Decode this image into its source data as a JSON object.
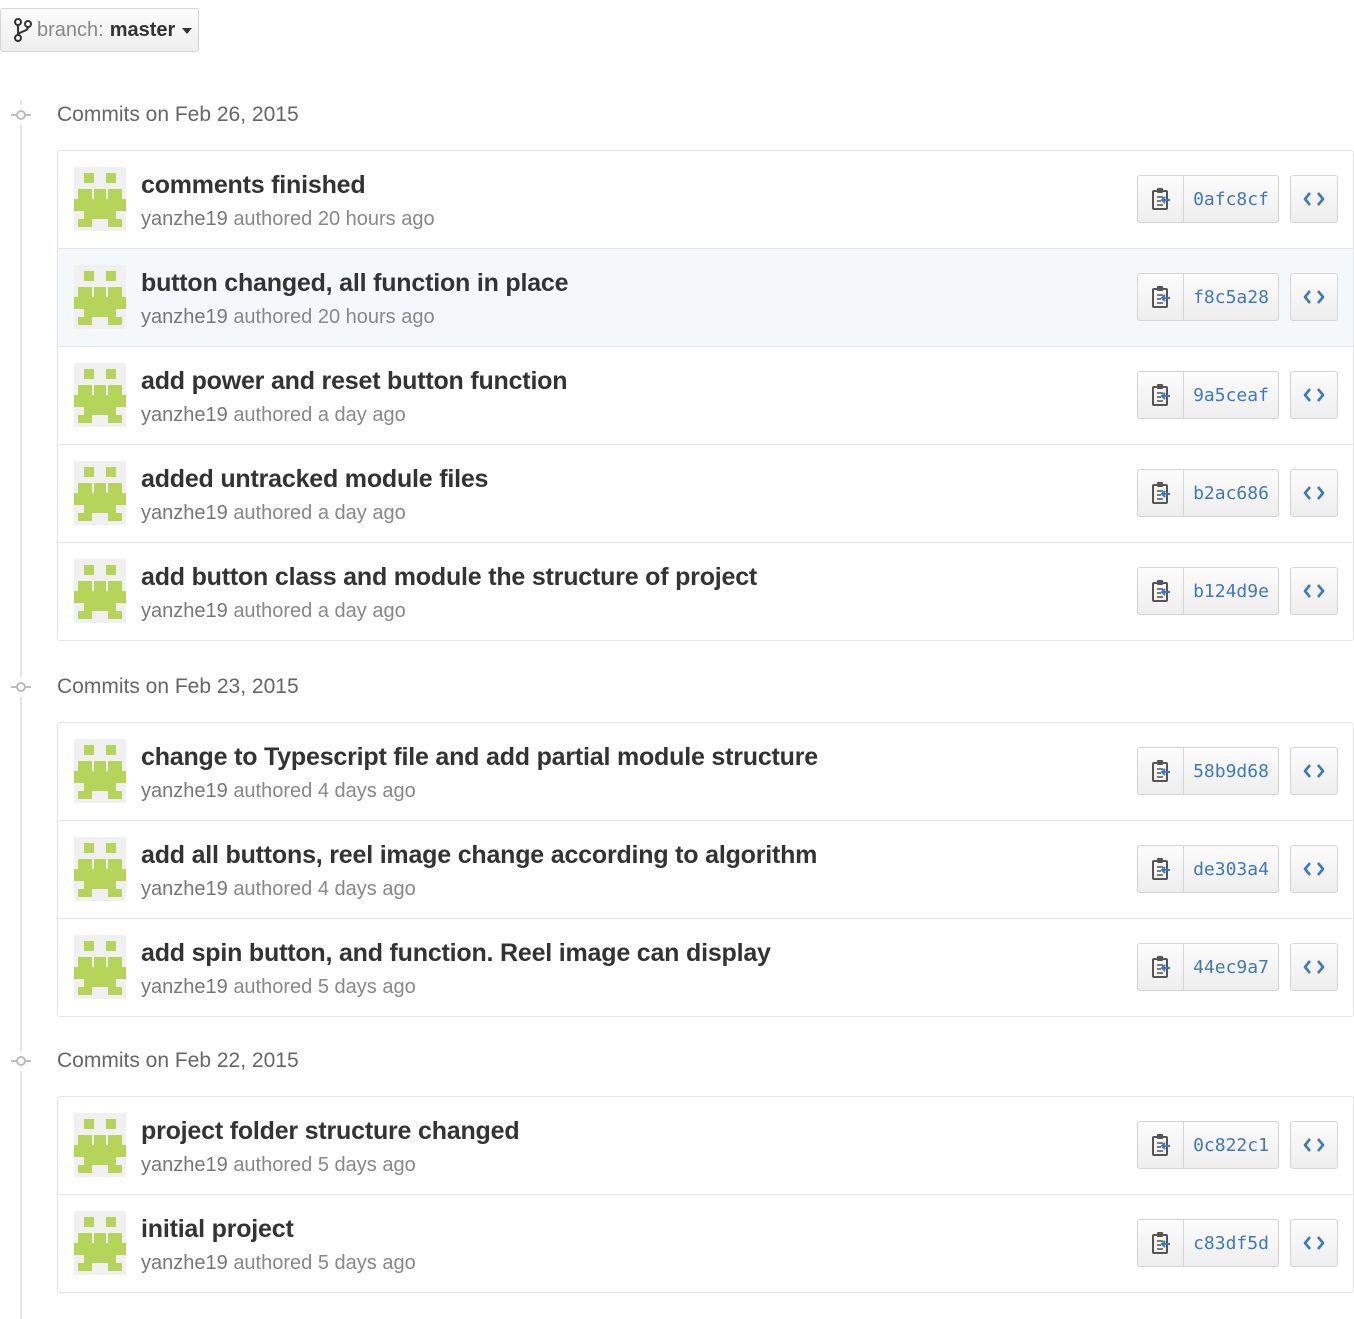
{
  "branch": {
    "prefix": "branch:",
    "name": "master"
  },
  "groups": [
    {
      "title": "Commits on Feb 26, 2015",
      "commits": [
        {
          "message": "comments finished",
          "author": "yanzhe19",
          "verb": "authored",
          "time": "20 hours ago",
          "sha": "0afc8cf"
        },
        {
          "message": "button changed, all function in place",
          "author": "yanzhe19",
          "verb": "authored",
          "time": "20 hours ago",
          "sha": "f8c5a28"
        },
        {
          "message": "add power and reset button function",
          "author": "yanzhe19",
          "verb": "authored",
          "time": "a day ago",
          "sha": "9a5ceaf"
        },
        {
          "message": "added untracked module files",
          "author": "yanzhe19",
          "verb": "authored",
          "time": "a day ago",
          "sha": "b2ac686"
        },
        {
          "message": "add button class and module the structure of project",
          "author": "yanzhe19",
          "verb": "authored",
          "time": "a day ago",
          "sha": "b124d9e"
        }
      ]
    },
    {
      "title": "Commits on Feb 23, 2015",
      "commits": [
        {
          "message": "change to Typescript file and add partial module structure",
          "author": "yanzhe19",
          "verb": "authored",
          "time": "4 days ago",
          "sha": "58b9d68"
        },
        {
          "message": "add all buttons, reel image change according to algorithm",
          "author": "yanzhe19",
          "verb": "authored",
          "time": "4 days ago",
          "sha": "de303a4"
        },
        {
          "message": "add spin button, and function. Reel image can display",
          "author": "yanzhe19",
          "verb": "authored",
          "time": "5 days ago",
          "sha": "44ec9a7"
        }
      ]
    },
    {
      "title": "Commits on Feb 22, 2015",
      "commits": [
        {
          "message": "project folder structure changed",
          "author": "yanzhe19",
          "verb": "authored",
          "time": "5 days ago",
          "sha": "0c822c1"
        },
        {
          "message": "initial project",
          "author": "yanzhe19",
          "verb": "authored",
          "time": "5 days ago",
          "sha": "c83df5d"
        }
      ]
    }
  ],
  "icons": {
    "branch": "git-branch-icon",
    "timeline": "git-commit-icon",
    "avatar": "identicon-avatar",
    "copy": "clippy-icon",
    "browse": "code-icon"
  },
  "colors": {
    "link": "#4078c0",
    "avatar": "#b5d55a",
    "muted": "#888888",
    "text": "#333333",
    "border": "#e5e5e5",
    "hover_row": "#f5f8fa"
  },
  "hovered_commit": "f8c5a28"
}
